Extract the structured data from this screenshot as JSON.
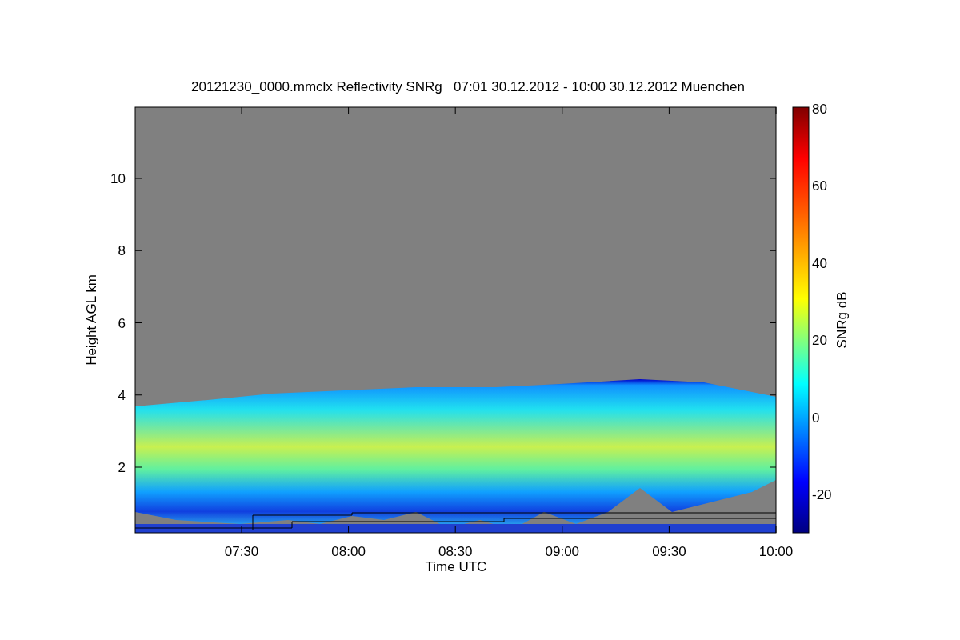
{
  "figure": {
    "title": "20121230_0000.mmclx Reflectivity SNRg   07:01 30.12.2012 - 10:00 30.12.2012 Muenchen",
    "y_axis": {
      "label": "Height AGL km",
      "ticks": [
        "10",
        "8",
        "6",
        "4",
        "2"
      ]
    },
    "x_axis": {
      "label": "Time UTC",
      "ticks": [
        "07:30",
        "08:00",
        "08:30",
        "09:00",
        "09:30",
        "10:00"
      ]
    },
    "colorbar": {
      "label": "SNRg dB",
      "ticks": [
        "80",
        "60",
        "40",
        "20",
        "0",
        "-20"
      ]
    }
  }
}
